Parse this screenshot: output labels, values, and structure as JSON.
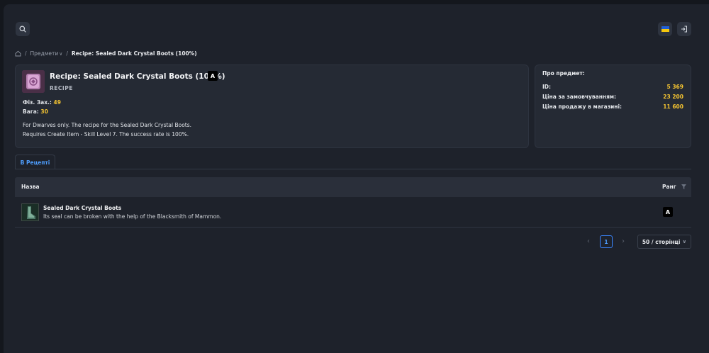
{
  "header": {
    "search_icon": "search-icon",
    "flag_icon": "ukraine-flag-icon",
    "login_icon": "login-icon",
    "colors": {
      "flag_blue": "#1f5fd6",
      "flag_yellow": "#f5c70d",
      "accent": "#4f9fff",
      "value": "#f5c431"
    }
  },
  "breadcrumb": {
    "home_icon": "home-icon",
    "sep": "/",
    "items_label": "Предмети",
    "current": "Recipe: Sealed Dark Crystal Boots (100%)"
  },
  "item": {
    "title": "Recipe: Sealed Dark Crystal Boots (100%)",
    "grade": "A",
    "type": "RECIPE",
    "stats": [
      {
        "label": "Фіз. Зах.:",
        "value": "49"
      },
      {
        "label": "Вага:",
        "value": "30"
      }
    ],
    "description": [
      "For Dwarves only. The recipe for the Sealed Dark Crystal Boots.",
      "Requires Create Item - Skill Level 7. The success rate is 100%."
    ]
  },
  "about": {
    "title": "Про предмет:",
    "rows": [
      {
        "label": "ID:",
        "value": "5 369"
      },
      {
        "label": "Ціна за замовчуванням:",
        "value": "23 200"
      },
      {
        "label": "Ціна продажу в магазині:",
        "value": "11 600"
      }
    ]
  },
  "tabs": [
    {
      "label": "В Рецепті",
      "active": true
    }
  ],
  "table": {
    "columns": {
      "name": "Назва",
      "grade": "Ранг",
      "filter_icon": "filter-icon"
    },
    "rows": [
      {
        "name": "Sealed Dark Crystal Boots",
        "description": "Its seal can be broken with the help of the Blacksmith of Mammon.",
        "grade": "A"
      }
    ]
  },
  "pagination": {
    "prev": "‹",
    "next": "›",
    "current_page": "1",
    "page_size": "50 / сторінці"
  }
}
